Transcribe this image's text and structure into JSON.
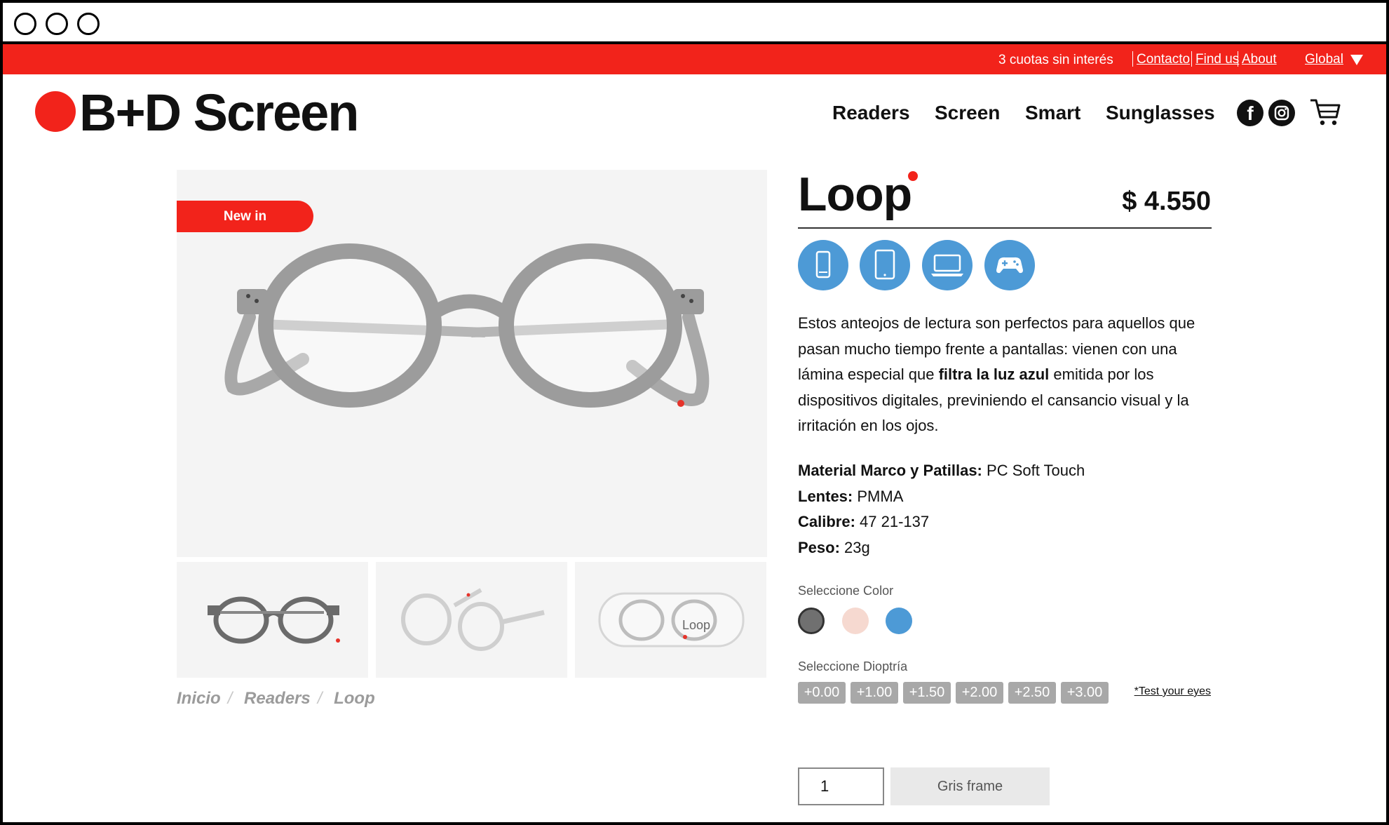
{
  "topbar": {
    "promo": "3 cuotas sin interés",
    "links": [
      "Contacto",
      "Find us",
      "About"
    ],
    "region": "Global"
  },
  "header": {
    "logo": "B+D Screen",
    "nav": [
      "Readers",
      "Screen",
      "Smart",
      "Sunglasses"
    ],
    "icons": [
      "facebook-icon",
      "instagram-icon",
      "cart-icon"
    ]
  },
  "gallery": {
    "badge": "New in",
    "thumb_case_text": "Loop"
  },
  "breadcrumb": [
    "Inicio",
    "Readers",
    "Loop"
  ],
  "product": {
    "name": "Loop",
    "price": "$ 4.550",
    "device_icons": [
      "phone-icon",
      "tablet-icon",
      "laptop-icon",
      "gamepad-icon"
    ],
    "description": {
      "part1": "Estos anteojos de lectura son perfectos para aquellos que pasan mucho tiempo frente a pantallas: vienen con una lámina especial que",
      "bold": "filtra la luz azul",
      "part2": "emitida por los dispositivos digitales, previniendo el cansancio visual y la irritación en los ojos."
    },
    "specs": [
      {
        "label": "Material Marco y Patillas:",
        "value": "PC Soft Touch"
      },
      {
        "label": "Lentes:",
        "value": "PMMA"
      },
      {
        "label": "Calibre:",
        "value": "47 21-137"
      },
      {
        "label": "Peso:",
        "value": "23g"
      }
    ],
    "color_label": "Seleccione Color",
    "colors": [
      "#707070",
      "#f6d9d0",
      "#4d9ad6"
    ],
    "diopter_label": "Seleccione Dioptría",
    "diopters": [
      "+0.00",
      "+1.00",
      "+1.50",
      "+2.00",
      "+2.50",
      "+3.00"
    ],
    "test_link": "*Test your eyes",
    "quantity": "1",
    "cta": "Gris frame"
  },
  "colors": {
    "brand_red": "#f2231b",
    "device_blue": "#4d9ad6"
  }
}
